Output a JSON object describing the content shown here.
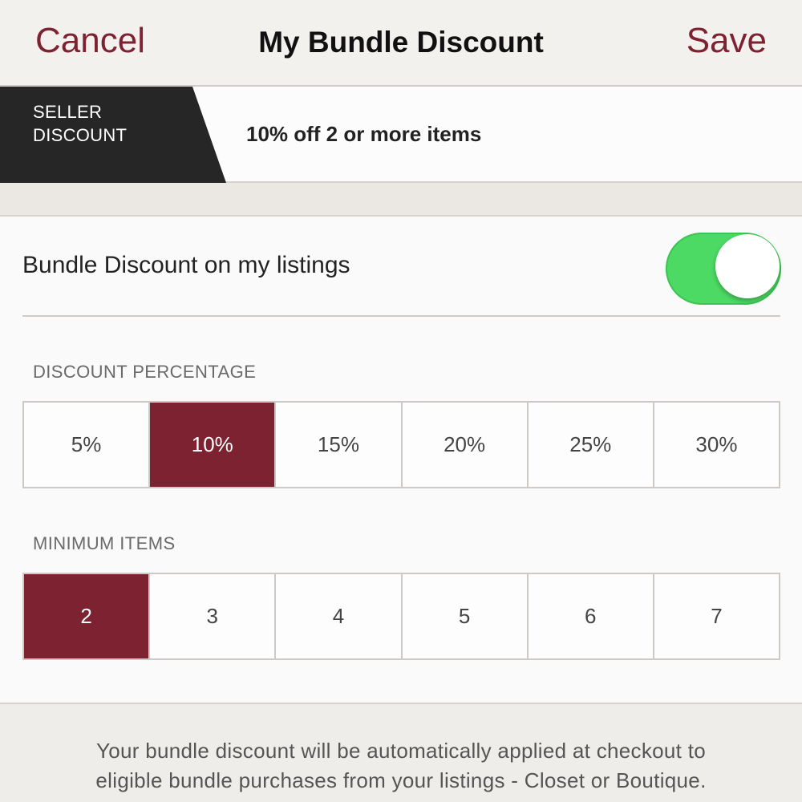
{
  "nav": {
    "cancel_label": "Cancel",
    "title": "My Bundle Discount",
    "save_label": "Save"
  },
  "banner": {
    "tag_line1": "SELLER",
    "tag_line2": "DISCOUNT",
    "summary": "10% off 2 or more items"
  },
  "toggle": {
    "label": "Bundle Discount on my listings",
    "state": "on",
    "color": "#4cd964"
  },
  "discount": {
    "heading": "DISCOUNT PERCENTAGE",
    "options": [
      "5%",
      "10%",
      "15%",
      "20%",
      "25%",
      "30%"
    ],
    "selected": "10%"
  },
  "minimum": {
    "heading": "MINIMUM ITEMS",
    "options": [
      "2",
      "3",
      "4",
      "5",
      "6",
      "7"
    ],
    "selected": "2"
  },
  "footer": {
    "line1": "Your bundle discount will be automatically applied at checkout to",
    "line2": "eligible bundle purchases from your listings - Closet or Boutique."
  },
  "colors": {
    "accent": "#7d2230",
    "toggle_on": "#4cd964",
    "tag_bg": "#262626"
  }
}
